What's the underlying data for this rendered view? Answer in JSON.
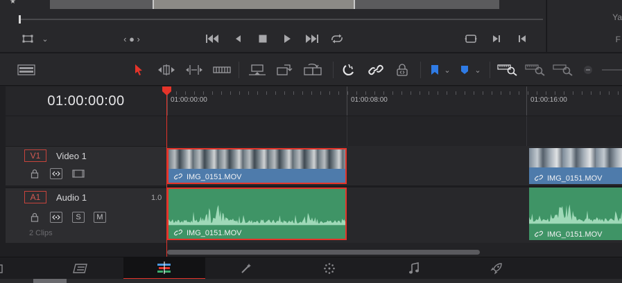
{
  "viewer": {
    "nav_dots": "‹ ● ›"
  },
  "inspector": {
    "label_1": "Ya",
    "label_2": "F"
  },
  "timeline": {
    "timecode": "01:00:00:00",
    "ruler_labels": [
      "01:00:00:00",
      "01:00:08:00",
      "01:00:16:00"
    ]
  },
  "tracks": {
    "video": {
      "badge": "V1",
      "name": "Video 1"
    },
    "audio": {
      "badge": "A1",
      "name": "Audio 1",
      "volume": "1.0",
      "clip_count": "2 Clips",
      "solo_label": "S",
      "mute_label": "M"
    }
  },
  "clips": {
    "video_1": "IMG_0151.MOV",
    "video_2": "IMG_0151.MOV",
    "audio_1": "IMG_0151.MOV",
    "audio_2": "IMG_0151.MOV"
  },
  "colors": {
    "accent_red": "#e5342a",
    "video_clip": "#4e7bab",
    "audio_clip": "#3f9466",
    "flag_blue": "#2f7be5"
  },
  "pages": [
    "media",
    "cut",
    "edit",
    "fusion",
    "color",
    "fairlight",
    "deliver"
  ],
  "active_page": "edit"
}
